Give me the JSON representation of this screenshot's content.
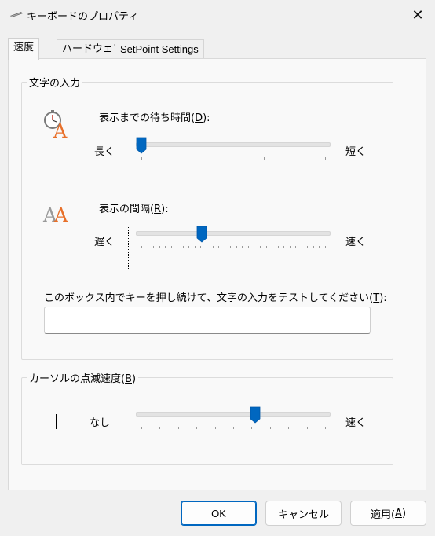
{
  "window": {
    "title": "キーボードのプロパティ",
    "close_glyph": "✕"
  },
  "tabs": [
    {
      "label": "速度",
      "selected": true
    },
    {
      "label": "ハードウェア",
      "selected": false
    },
    {
      "label": "SetPoint Settings",
      "selected": false
    }
  ],
  "char_input": {
    "group_label": "文字の入力",
    "delay": {
      "label_text": "表示までの待ち時間(",
      "label_key": "D",
      "label_end": "):",
      "min_label": "長く",
      "max_label": "短く",
      "level": 0.0,
      "ticks": 4
    },
    "rate": {
      "label_text": "表示の間隔(",
      "label_key": "R",
      "label_end": "):",
      "min_label": "遅く",
      "max_label": "速く",
      "level": 0.33,
      "ticks": 32
    },
    "test": {
      "label_text": "このボックス内でキーを押し続けて、文字の入力をテストしてください(",
      "label_key": "T",
      "label_end": "):",
      "value": ""
    }
  },
  "cursor_blink": {
    "group_label_text": "カーソルの点滅速度(",
    "group_label_key": "B",
    "group_label_end": ")",
    "min_label": "なし",
    "max_label": "速く",
    "level": 0.62,
    "ticks": 11
  },
  "buttons": {
    "ok": "OK",
    "cancel": "キャンセル",
    "apply_text": "適用(",
    "apply_key": "A",
    "apply_end": ")"
  },
  "colors": {
    "accent": "#0067c0",
    "icon_orange": "#e8702a",
    "icon_gray": "#9a9a9a"
  }
}
